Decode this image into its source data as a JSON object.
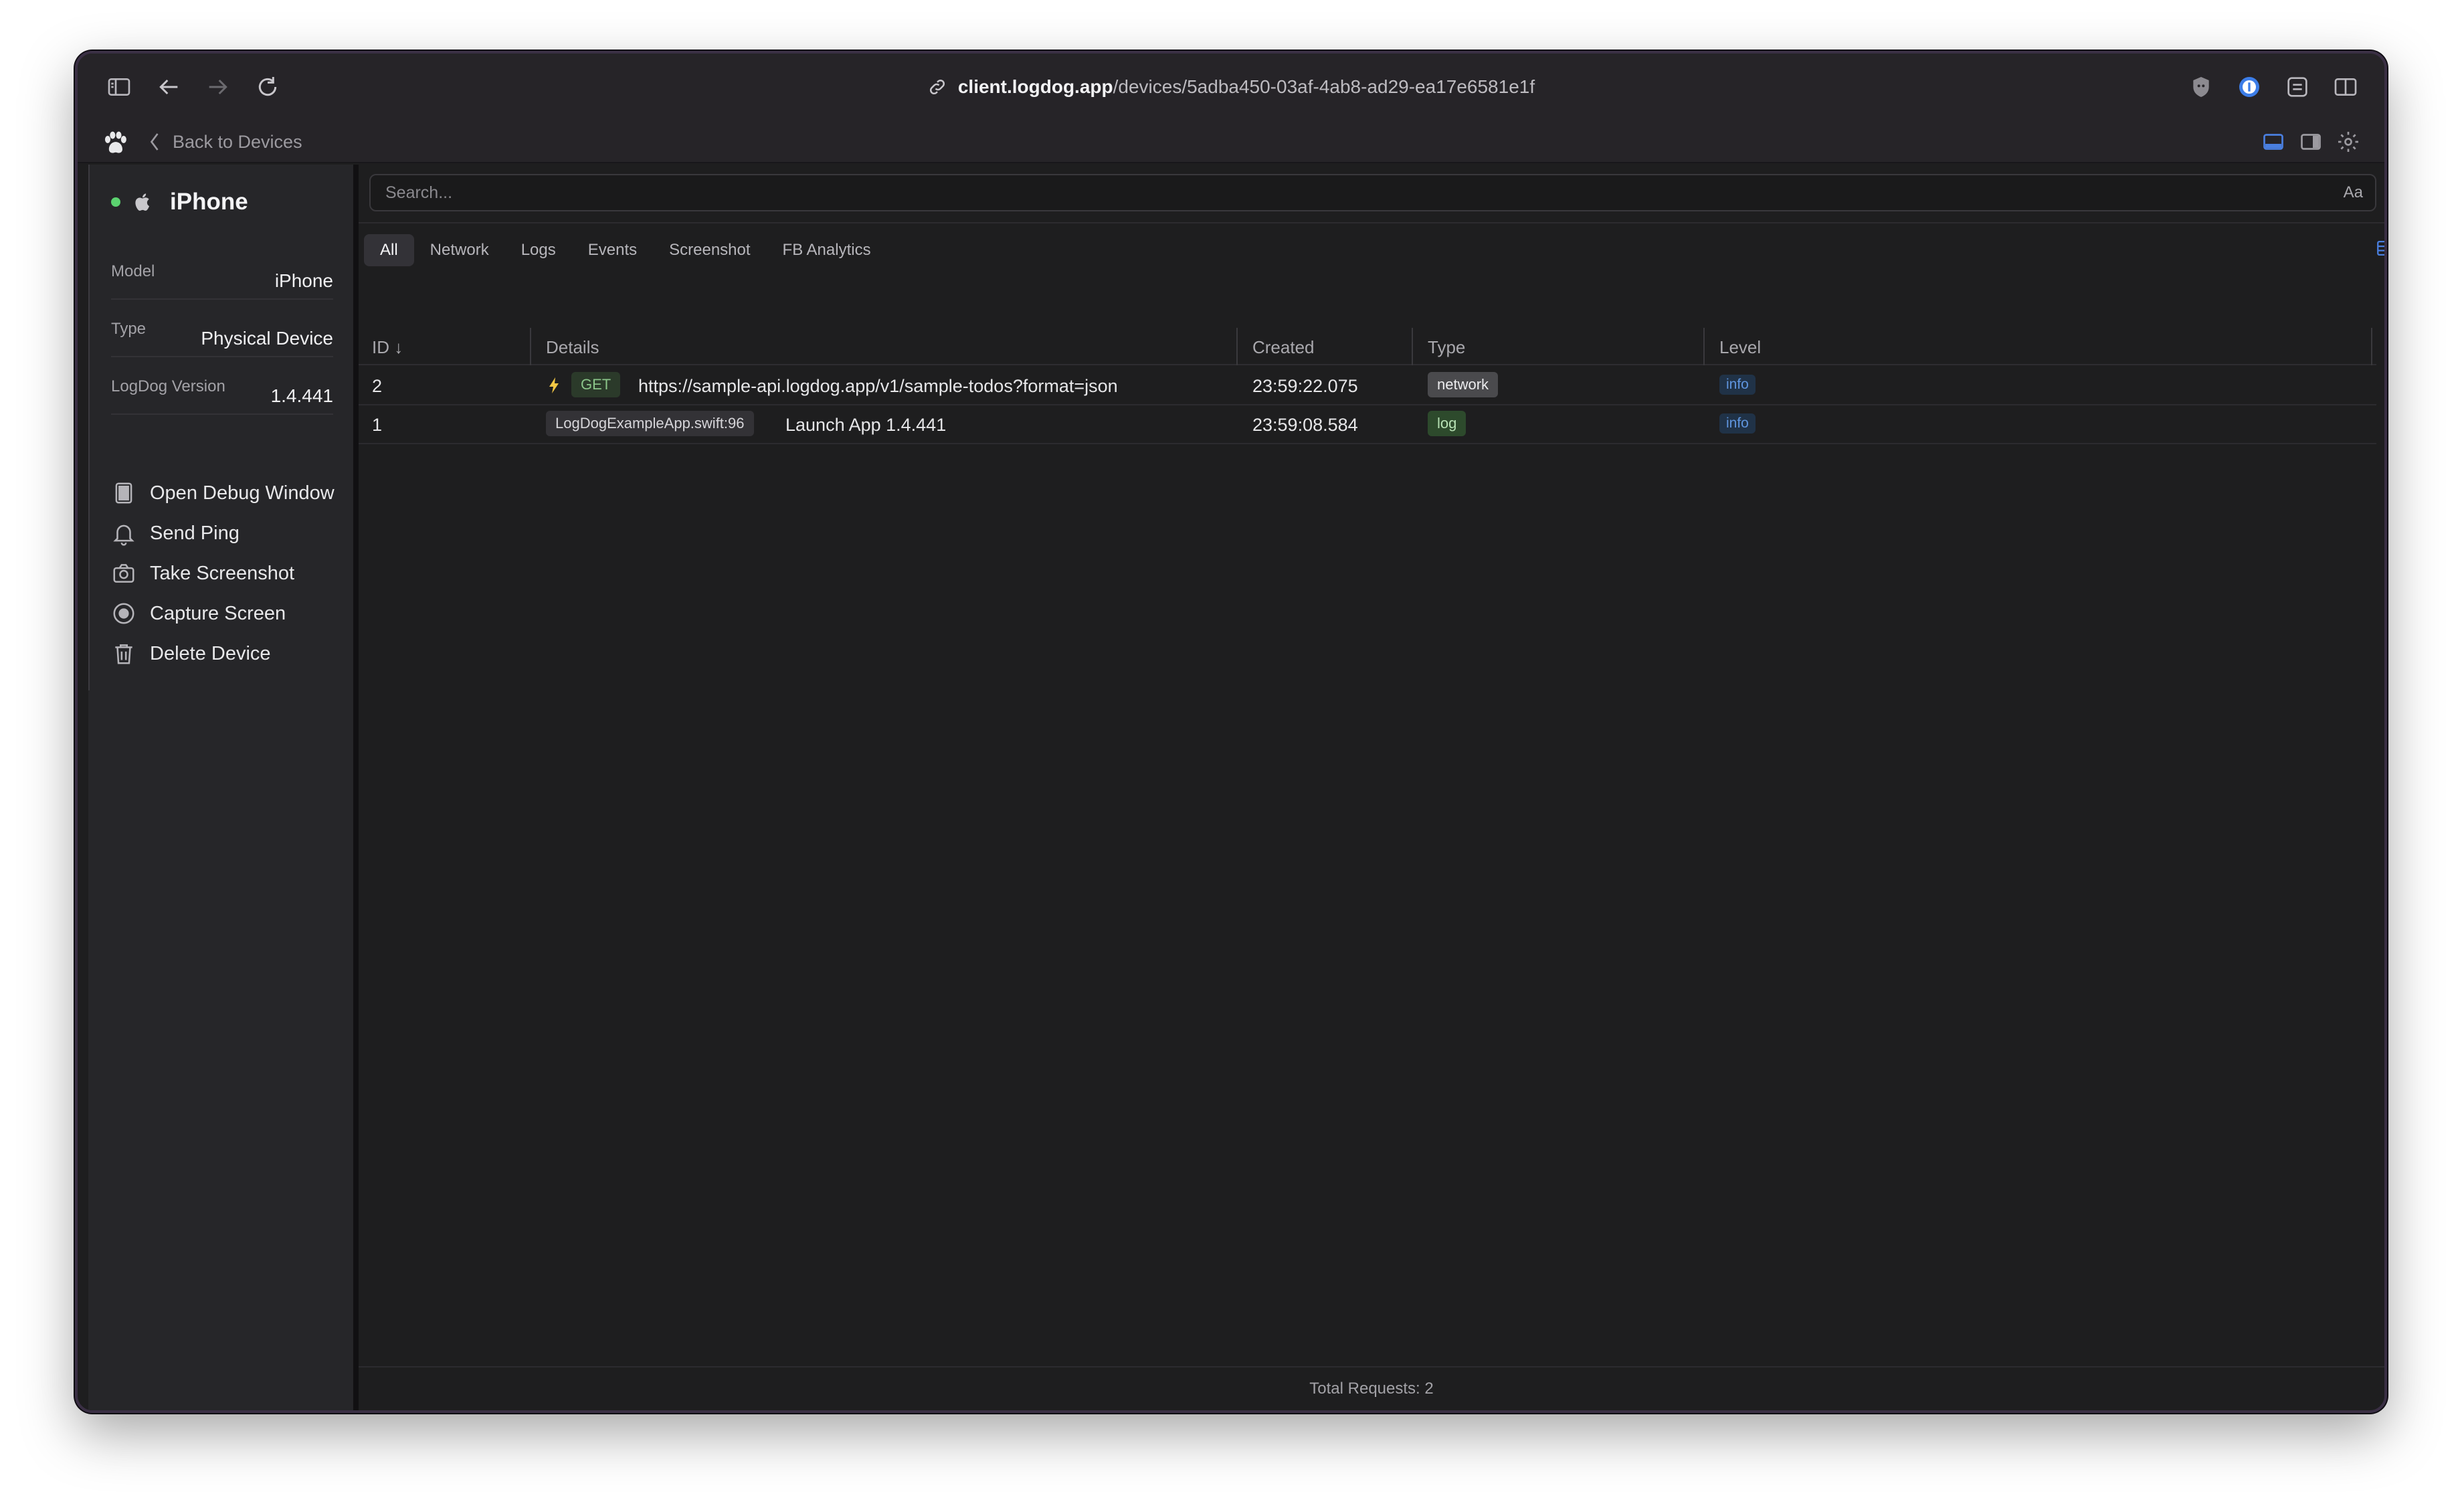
{
  "browser": {
    "url_host": "client.logdog.app",
    "url_path": "/devices/5adba450-03af-4ab8-ad29-ea17e6581e1f"
  },
  "app_header": {
    "back_label": "Back to Devices"
  },
  "device": {
    "name": "iPhone",
    "status_color": "#5bd26f",
    "properties": [
      {
        "key": "Model",
        "value": "iPhone"
      },
      {
        "key": "Type",
        "value": "Physical Device"
      },
      {
        "key": "LogDog Version",
        "value": "1.4.441"
      }
    ],
    "actions": [
      {
        "label": "Open Debug Window",
        "icon": "window-icon"
      },
      {
        "label": "Send Ping",
        "icon": "bell-icon"
      },
      {
        "label": "Take Screenshot",
        "icon": "camera-icon"
      },
      {
        "label": "Capture Screen",
        "icon": "record-icon"
      },
      {
        "label": "Delete Device",
        "icon": "trash-icon"
      }
    ]
  },
  "search": {
    "placeholder": "Search...",
    "case_toggle": "Aa"
  },
  "tabs": [
    "All",
    "Network",
    "Logs",
    "Events",
    "Screenshot",
    "FB Analytics"
  ],
  "table": {
    "headers": {
      "id": "ID",
      "details": "Details",
      "created": "Created",
      "type": "Type",
      "level": "Level"
    },
    "rows": [
      {
        "id": "2",
        "method": "GET",
        "details": "https://sample-api.logdog.app/v1/sample-todos?format=json",
        "created": "23:59:22.075",
        "type": "network",
        "level": "info"
      },
      {
        "id": "1",
        "source": "LogDogExampleApp.swift:96",
        "details": "Launch App 1.4.441",
        "created": "23:59:08.584",
        "type": "log",
        "level": "info"
      }
    ]
  },
  "footer": {
    "total_label": "Total Requests: 2"
  },
  "colors": {
    "accent_blue": "#4a7fe0",
    "background": "#1e1e1f",
    "sidebar": "#262629"
  }
}
